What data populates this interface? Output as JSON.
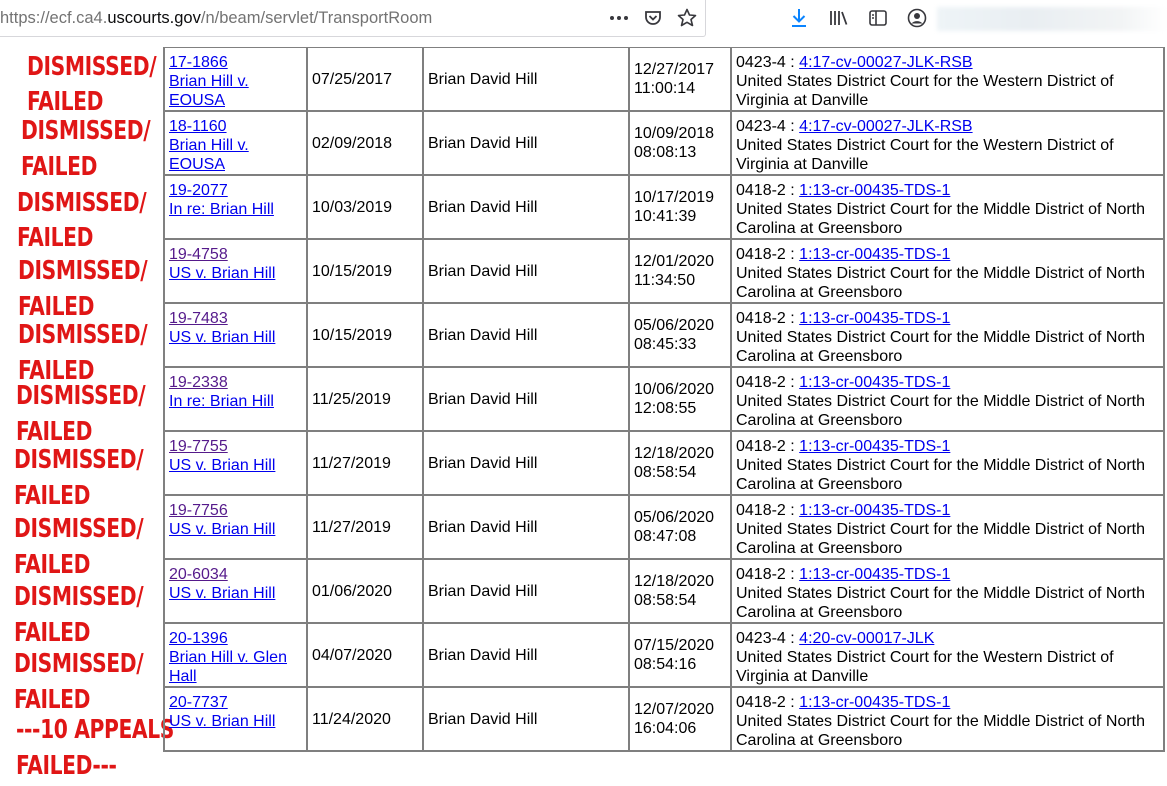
{
  "browser": {
    "url_prefix": "https://ecf.ca4.",
    "url_host": "uscourts.gov",
    "url_path": "/n/beam/servlet/TransportRoom",
    "icons": [
      "more-actions-icon",
      "pocket-icon",
      "bookmark-star-icon",
      "download-icon",
      "library-icon",
      "sidebar-icon",
      "account-icon"
    ]
  },
  "annotation": {
    "color": "#e01616",
    "lines": [
      "DISMISSED/",
      "FAILED",
      "DISMISSED/",
      "FAILED",
      "DISMISSED/",
      "FAILED",
      "DISMISSED/",
      "FAILED",
      "DISMISSED/",
      "FAILED",
      "DISMISSED/",
      "FAILED",
      "DISMISSED/",
      "FAILED",
      "DISMISSED/",
      "FAILED",
      "DISMISSED/",
      "FAILED",
      "DISMISSED/",
      "FAILED",
      "---10 APPEALS",
      "FAILED---"
    ]
  },
  "cases": [
    {
      "case_no": "17-1866",
      "title": "Brian Hill v. EOUSA",
      "filed": "07/25/2017",
      "party": "Brian David Hill",
      "date": "12/27/2017",
      "time": "11:00:14",
      "origin_code": "0423-4",
      "origin_case": "4:17-cv-00027-JLK-RSB",
      "court": "United States District Court for the Western District of Virginia at Danville"
    },
    {
      "case_no": "18-1160",
      "title": "Brian Hill v. EOUSA",
      "filed": "02/09/2018",
      "party": "Brian David Hill",
      "date": "10/09/2018",
      "time": "08:08:13",
      "origin_code": "0423-4",
      "origin_case": "4:17-cv-00027-JLK-RSB",
      "court": "United States District Court for the Western District of Virginia at Danville"
    },
    {
      "case_no": "19-2077",
      "title": "In re: Brian Hill",
      "filed": "10/03/2019",
      "party": "Brian David Hill",
      "date": "10/17/2019",
      "time": "10:41:39",
      "origin_code": "0418-2",
      "origin_case": "1:13-cr-00435-TDS-1",
      "court": "United States District Court for the Middle District of North Carolina at Greensboro"
    },
    {
      "case_no": "19-4758",
      "title": "US v. Brian Hill",
      "filed": "10/15/2019",
      "party": "Brian David Hill",
      "date": "12/01/2020",
      "time": "11:34:50",
      "origin_code": "0418-2",
      "origin_case": "1:13-cr-00435-TDS-1",
      "court": "United States District Court for the Middle District of North Carolina at Greensboro"
    },
    {
      "case_no": "19-7483",
      "title": "US v. Brian Hill",
      "filed": "10/15/2019",
      "party": "Brian David Hill",
      "date": "05/06/2020",
      "time": "08:45:33",
      "origin_code": "0418-2",
      "origin_case": "1:13-cr-00435-TDS-1",
      "court": "United States District Court for the Middle District of North Carolina at Greensboro"
    },
    {
      "case_no": "19-2338",
      "title": "In re: Brian Hill",
      "filed": "11/25/2019",
      "party": "Brian David Hill",
      "date": "10/06/2020",
      "time": "12:08:55",
      "origin_code": "0418-2",
      "origin_case": "1:13-cr-00435-TDS-1",
      "court": "United States District Court for the Middle District of North Carolina at Greensboro"
    },
    {
      "case_no": "19-7755",
      "title": "US v. Brian Hill",
      "filed": "11/27/2019",
      "party": "Brian David Hill",
      "date": "12/18/2020",
      "time": "08:58:54",
      "origin_code": "0418-2",
      "origin_case": "1:13-cr-00435-TDS-1",
      "court": "United States District Court for the Middle District of North Carolina at Greensboro"
    },
    {
      "case_no": "19-7756",
      "title": "US v. Brian Hill",
      "filed": "11/27/2019",
      "party": "Brian David Hill",
      "date": "05/06/2020",
      "time": "08:47:08",
      "origin_code": "0418-2",
      "origin_case": "1:13-cr-00435-TDS-1",
      "court": "United States District Court for the Middle District of North Carolina at Greensboro"
    },
    {
      "case_no": "20-6034",
      "title": "US v. Brian Hill",
      "filed": "01/06/2020",
      "party": "Brian David Hill",
      "date": "12/18/2020",
      "time": "08:58:54",
      "origin_code": "0418-2",
      "origin_case": "1:13-cr-00435-TDS-1",
      "court": "United States District Court for the Middle District of North Carolina at Greensboro"
    },
    {
      "case_no": "20-1396",
      "title": "Brian Hill v. Glen Hall",
      "filed": "04/07/2020",
      "party": "Brian David Hill",
      "date": "07/15/2020",
      "time": "08:54:16",
      "origin_code": "0423-4",
      "origin_case": "4:20-cv-00017-JLK",
      "court": "United States District Court for the Western District of Virginia at Danville"
    },
    {
      "case_no": "20-7737",
      "title": "US v. Brian Hill",
      "filed": "11/24/2020",
      "party": "Brian David Hill",
      "date": "12/07/2020",
      "time": "16:04:06",
      "origin_code": "0418-2",
      "origin_case": "1:13-cr-00435-TDS-1",
      "court": "United States District Court for the Middle District of North Carolina at Greensboro"
    }
  ]
}
